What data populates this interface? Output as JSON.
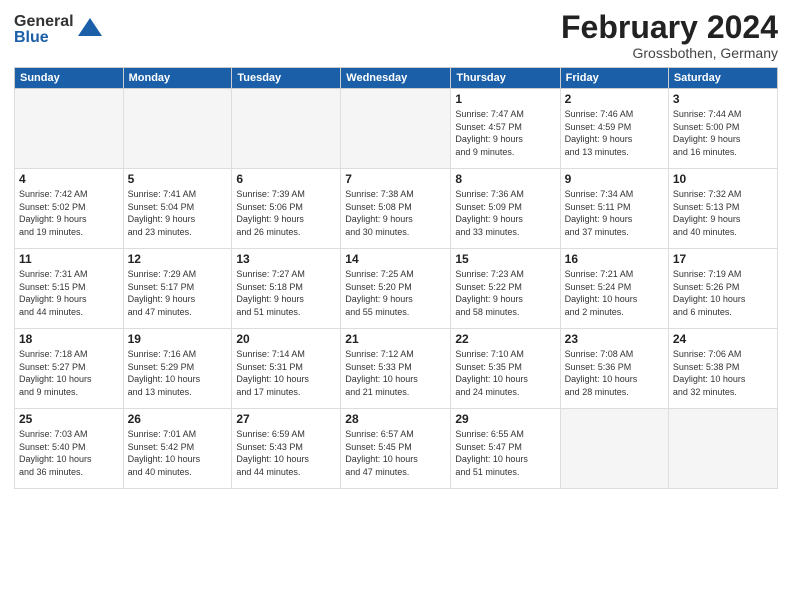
{
  "logo": {
    "general": "General",
    "blue": "Blue"
  },
  "title": "February 2024",
  "location": "Grossbothen, Germany",
  "weekdays": [
    "Sunday",
    "Monday",
    "Tuesday",
    "Wednesday",
    "Thursday",
    "Friday",
    "Saturday"
  ],
  "weeks": [
    [
      {
        "day": "",
        "info": ""
      },
      {
        "day": "",
        "info": ""
      },
      {
        "day": "",
        "info": ""
      },
      {
        "day": "",
        "info": ""
      },
      {
        "day": "1",
        "info": "Sunrise: 7:47 AM\nSunset: 4:57 PM\nDaylight: 9 hours\nand 9 minutes."
      },
      {
        "day": "2",
        "info": "Sunrise: 7:46 AM\nSunset: 4:59 PM\nDaylight: 9 hours\nand 13 minutes."
      },
      {
        "day": "3",
        "info": "Sunrise: 7:44 AM\nSunset: 5:00 PM\nDaylight: 9 hours\nand 16 minutes."
      }
    ],
    [
      {
        "day": "4",
        "info": "Sunrise: 7:42 AM\nSunset: 5:02 PM\nDaylight: 9 hours\nand 19 minutes."
      },
      {
        "day": "5",
        "info": "Sunrise: 7:41 AM\nSunset: 5:04 PM\nDaylight: 9 hours\nand 23 minutes."
      },
      {
        "day": "6",
        "info": "Sunrise: 7:39 AM\nSunset: 5:06 PM\nDaylight: 9 hours\nand 26 minutes."
      },
      {
        "day": "7",
        "info": "Sunrise: 7:38 AM\nSunset: 5:08 PM\nDaylight: 9 hours\nand 30 minutes."
      },
      {
        "day": "8",
        "info": "Sunrise: 7:36 AM\nSunset: 5:09 PM\nDaylight: 9 hours\nand 33 minutes."
      },
      {
        "day": "9",
        "info": "Sunrise: 7:34 AM\nSunset: 5:11 PM\nDaylight: 9 hours\nand 37 minutes."
      },
      {
        "day": "10",
        "info": "Sunrise: 7:32 AM\nSunset: 5:13 PM\nDaylight: 9 hours\nand 40 minutes."
      }
    ],
    [
      {
        "day": "11",
        "info": "Sunrise: 7:31 AM\nSunset: 5:15 PM\nDaylight: 9 hours\nand 44 minutes."
      },
      {
        "day": "12",
        "info": "Sunrise: 7:29 AM\nSunset: 5:17 PM\nDaylight: 9 hours\nand 47 minutes."
      },
      {
        "day": "13",
        "info": "Sunrise: 7:27 AM\nSunset: 5:18 PM\nDaylight: 9 hours\nand 51 minutes."
      },
      {
        "day": "14",
        "info": "Sunrise: 7:25 AM\nSunset: 5:20 PM\nDaylight: 9 hours\nand 55 minutes."
      },
      {
        "day": "15",
        "info": "Sunrise: 7:23 AM\nSunset: 5:22 PM\nDaylight: 9 hours\nand 58 minutes."
      },
      {
        "day": "16",
        "info": "Sunrise: 7:21 AM\nSunset: 5:24 PM\nDaylight: 10 hours\nand 2 minutes."
      },
      {
        "day": "17",
        "info": "Sunrise: 7:19 AM\nSunset: 5:26 PM\nDaylight: 10 hours\nand 6 minutes."
      }
    ],
    [
      {
        "day": "18",
        "info": "Sunrise: 7:18 AM\nSunset: 5:27 PM\nDaylight: 10 hours\nand 9 minutes."
      },
      {
        "day": "19",
        "info": "Sunrise: 7:16 AM\nSunset: 5:29 PM\nDaylight: 10 hours\nand 13 minutes."
      },
      {
        "day": "20",
        "info": "Sunrise: 7:14 AM\nSunset: 5:31 PM\nDaylight: 10 hours\nand 17 minutes."
      },
      {
        "day": "21",
        "info": "Sunrise: 7:12 AM\nSunset: 5:33 PM\nDaylight: 10 hours\nand 21 minutes."
      },
      {
        "day": "22",
        "info": "Sunrise: 7:10 AM\nSunset: 5:35 PM\nDaylight: 10 hours\nand 24 minutes."
      },
      {
        "day": "23",
        "info": "Sunrise: 7:08 AM\nSunset: 5:36 PM\nDaylight: 10 hours\nand 28 minutes."
      },
      {
        "day": "24",
        "info": "Sunrise: 7:06 AM\nSunset: 5:38 PM\nDaylight: 10 hours\nand 32 minutes."
      }
    ],
    [
      {
        "day": "25",
        "info": "Sunrise: 7:03 AM\nSunset: 5:40 PM\nDaylight: 10 hours\nand 36 minutes."
      },
      {
        "day": "26",
        "info": "Sunrise: 7:01 AM\nSunset: 5:42 PM\nDaylight: 10 hours\nand 40 minutes."
      },
      {
        "day": "27",
        "info": "Sunrise: 6:59 AM\nSunset: 5:43 PM\nDaylight: 10 hours\nand 44 minutes."
      },
      {
        "day": "28",
        "info": "Sunrise: 6:57 AM\nSunset: 5:45 PM\nDaylight: 10 hours\nand 47 minutes."
      },
      {
        "day": "29",
        "info": "Sunrise: 6:55 AM\nSunset: 5:47 PM\nDaylight: 10 hours\nand 51 minutes."
      },
      {
        "day": "",
        "info": ""
      },
      {
        "day": "",
        "info": ""
      }
    ]
  ]
}
